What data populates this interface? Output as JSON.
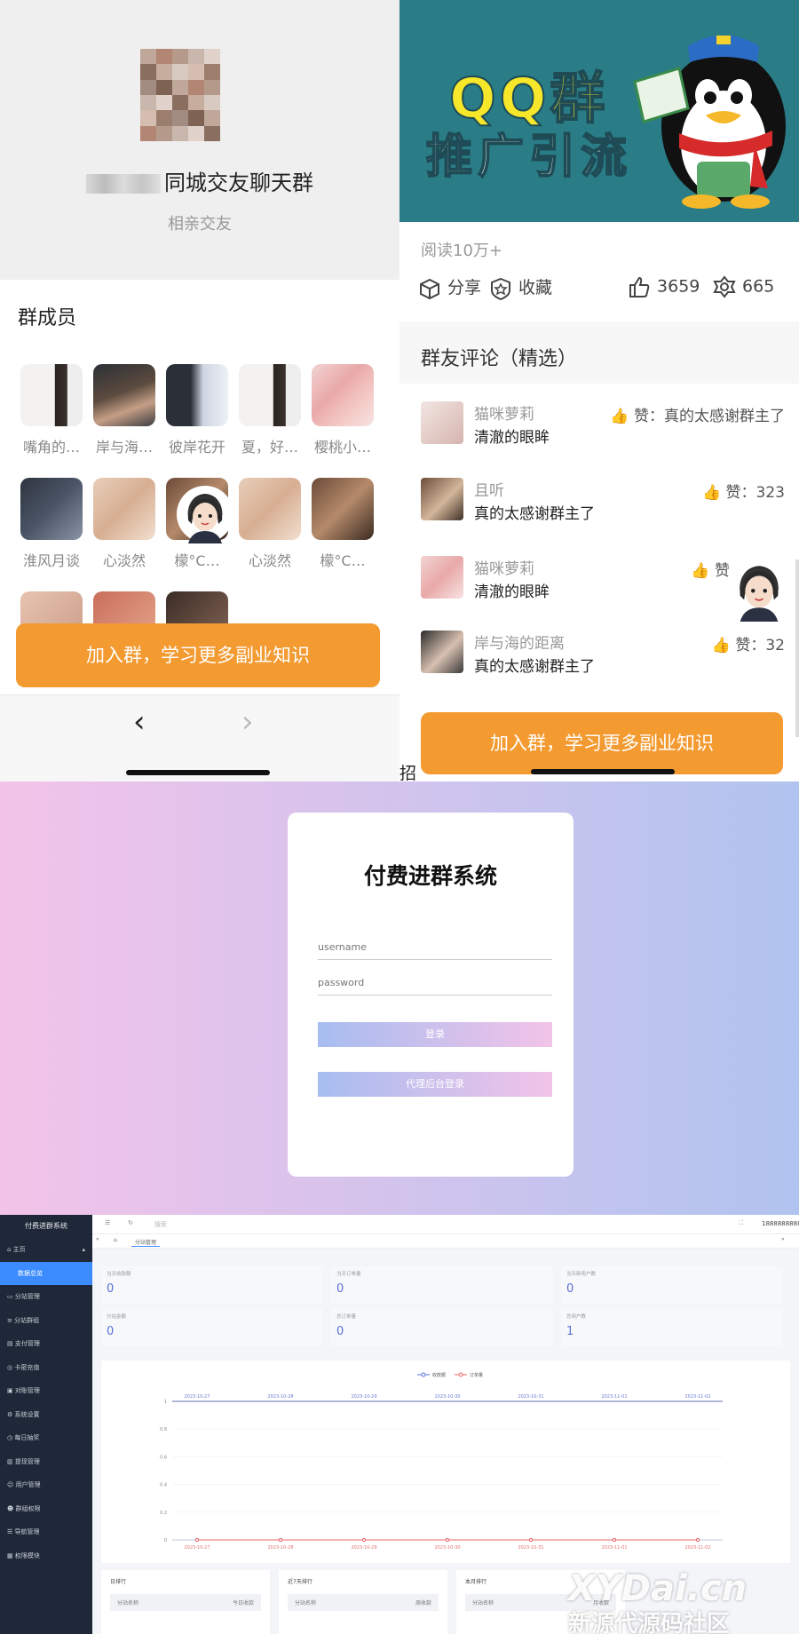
{
  "left_panel": {
    "group_name": "同城交友聊天群",
    "group_subtitle": "相亲交友",
    "members_heading": "群成员",
    "members": [
      {
        "name": "嘴角的…"
      },
      {
        "name": "岸与海…"
      },
      {
        "name": "彼岸花开"
      },
      {
        "name": "夏，好…"
      },
      {
        "name": "樱桃小…"
      },
      {
        "name": "淮风月谈"
      },
      {
        "name": "心淡然"
      },
      {
        "name": "檬°C…"
      },
      {
        "name": "心淡然"
      },
      {
        "name": "檬°C…"
      }
    ],
    "join_button": "加入群，学习更多副业知识",
    "nav_prev": "‹",
    "nav_next": "›"
  },
  "right_panel": {
    "banner_line1": "QQ群",
    "banner_line2": "推广引流",
    "reads": "阅读10万+",
    "share_label": "分享",
    "favorite_label": "收藏",
    "like_count": "3659",
    "wow_count": "665",
    "comments_heading": "群友评论（精选）",
    "comments": [
      {
        "user": "猫咪萝莉",
        "text": "清澈的眼眸",
        "likes": "赞：真的太感谢群主了"
      },
      {
        "user": "且听",
        "text": "真的太感谢群主了",
        "likes": "赞：323"
      },
      {
        "user": "猫咪萝莉",
        "text": "清澈的眼眸",
        "likes": "赞"
      },
      {
        "user": "岸与海的距离",
        "text": "真的太感谢群主了",
        "likes": "赞：32"
      }
    ],
    "join_button": "加入群，学习更多副业知识",
    "footer_text": "招"
  },
  "login": {
    "title": "付费进群系统",
    "username_placeholder": "username",
    "password_placeholder": "password",
    "login_button": "登录",
    "agent_button": "代理后台登录"
  },
  "admin": {
    "app_title": "付费进群系统",
    "menu": [
      {
        "label": "主页",
        "state": "open"
      },
      {
        "label": "数据总览",
        "state": "active"
      },
      {
        "label": "分站管理"
      },
      {
        "label": "分站群组"
      },
      {
        "label": "支付管理"
      },
      {
        "label": "卡密充值"
      },
      {
        "label": "对账管理"
      },
      {
        "label": "系统设置"
      },
      {
        "label": "每日抽奖"
      },
      {
        "label": "提现管理"
      },
      {
        "label": "用户管理"
      },
      {
        "label": "群组权限"
      },
      {
        "label": "导航管理"
      },
      {
        "label": "权限模块"
      }
    ],
    "top_right_phone": "18888888888",
    "tab_label": "分站管理",
    "search_hint": "搜索",
    "stats": [
      {
        "label": "当天收款额",
        "value": "0"
      },
      {
        "label": "当天订单量",
        "value": "0"
      },
      {
        "label": "当天新用户数",
        "value": "0"
      },
      {
        "label": "分站金额",
        "value": "0"
      },
      {
        "label": "总订单量",
        "value": "0"
      },
      {
        "label": "总用户数",
        "value": "1"
      }
    ],
    "bottom_panels": [
      {
        "title": "日排行",
        "col1": "分站名称",
        "col2": "今日收款"
      },
      {
        "title": "近7天排行",
        "col1": "分站名称",
        "col2": "周收款"
      },
      {
        "title": "本月排行",
        "col1": "分站名称",
        "col2": "月收款"
      }
    ],
    "chart_data": {
      "type": "line",
      "categories": [
        "2023-10-27",
        "2023-10-28",
        "2023-10-29",
        "2023-10-30",
        "2023-10-31",
        "2023-11-01",
        "2023-11-02"
      ],
      "series": [
        {
          "name": "收款额",
          "values": [
            0,
            0,
            0,
            0,
            0,
            0,
            0
          ],
          "color": "#5a6fd6"
        },
        {
          "name": "订单量",
          "values": [
            0,
            0,
            0,
            0,
            0,
            0,
            0
          ],
          "color": "#ee6666"
        }
      ],
      "yticks": [
        "1",
        "0.8",
        "0.6",
        "0.4",
        "0.2",
        "0"
      ],
      "ylim": [
        0,
        1
      ],
      "legend": "top-center"
    }
  },
  "watermark": {
    "line1": "XYDai.cn",
    "line2": "新源代源码社区"
  },
  "colors": {
    "orange": "#f39a30",
    "teal": "#2a7d86",
    "admin_sidebar": "#1f2838",
    "admin_active": "#3d8cff"
  }
}
